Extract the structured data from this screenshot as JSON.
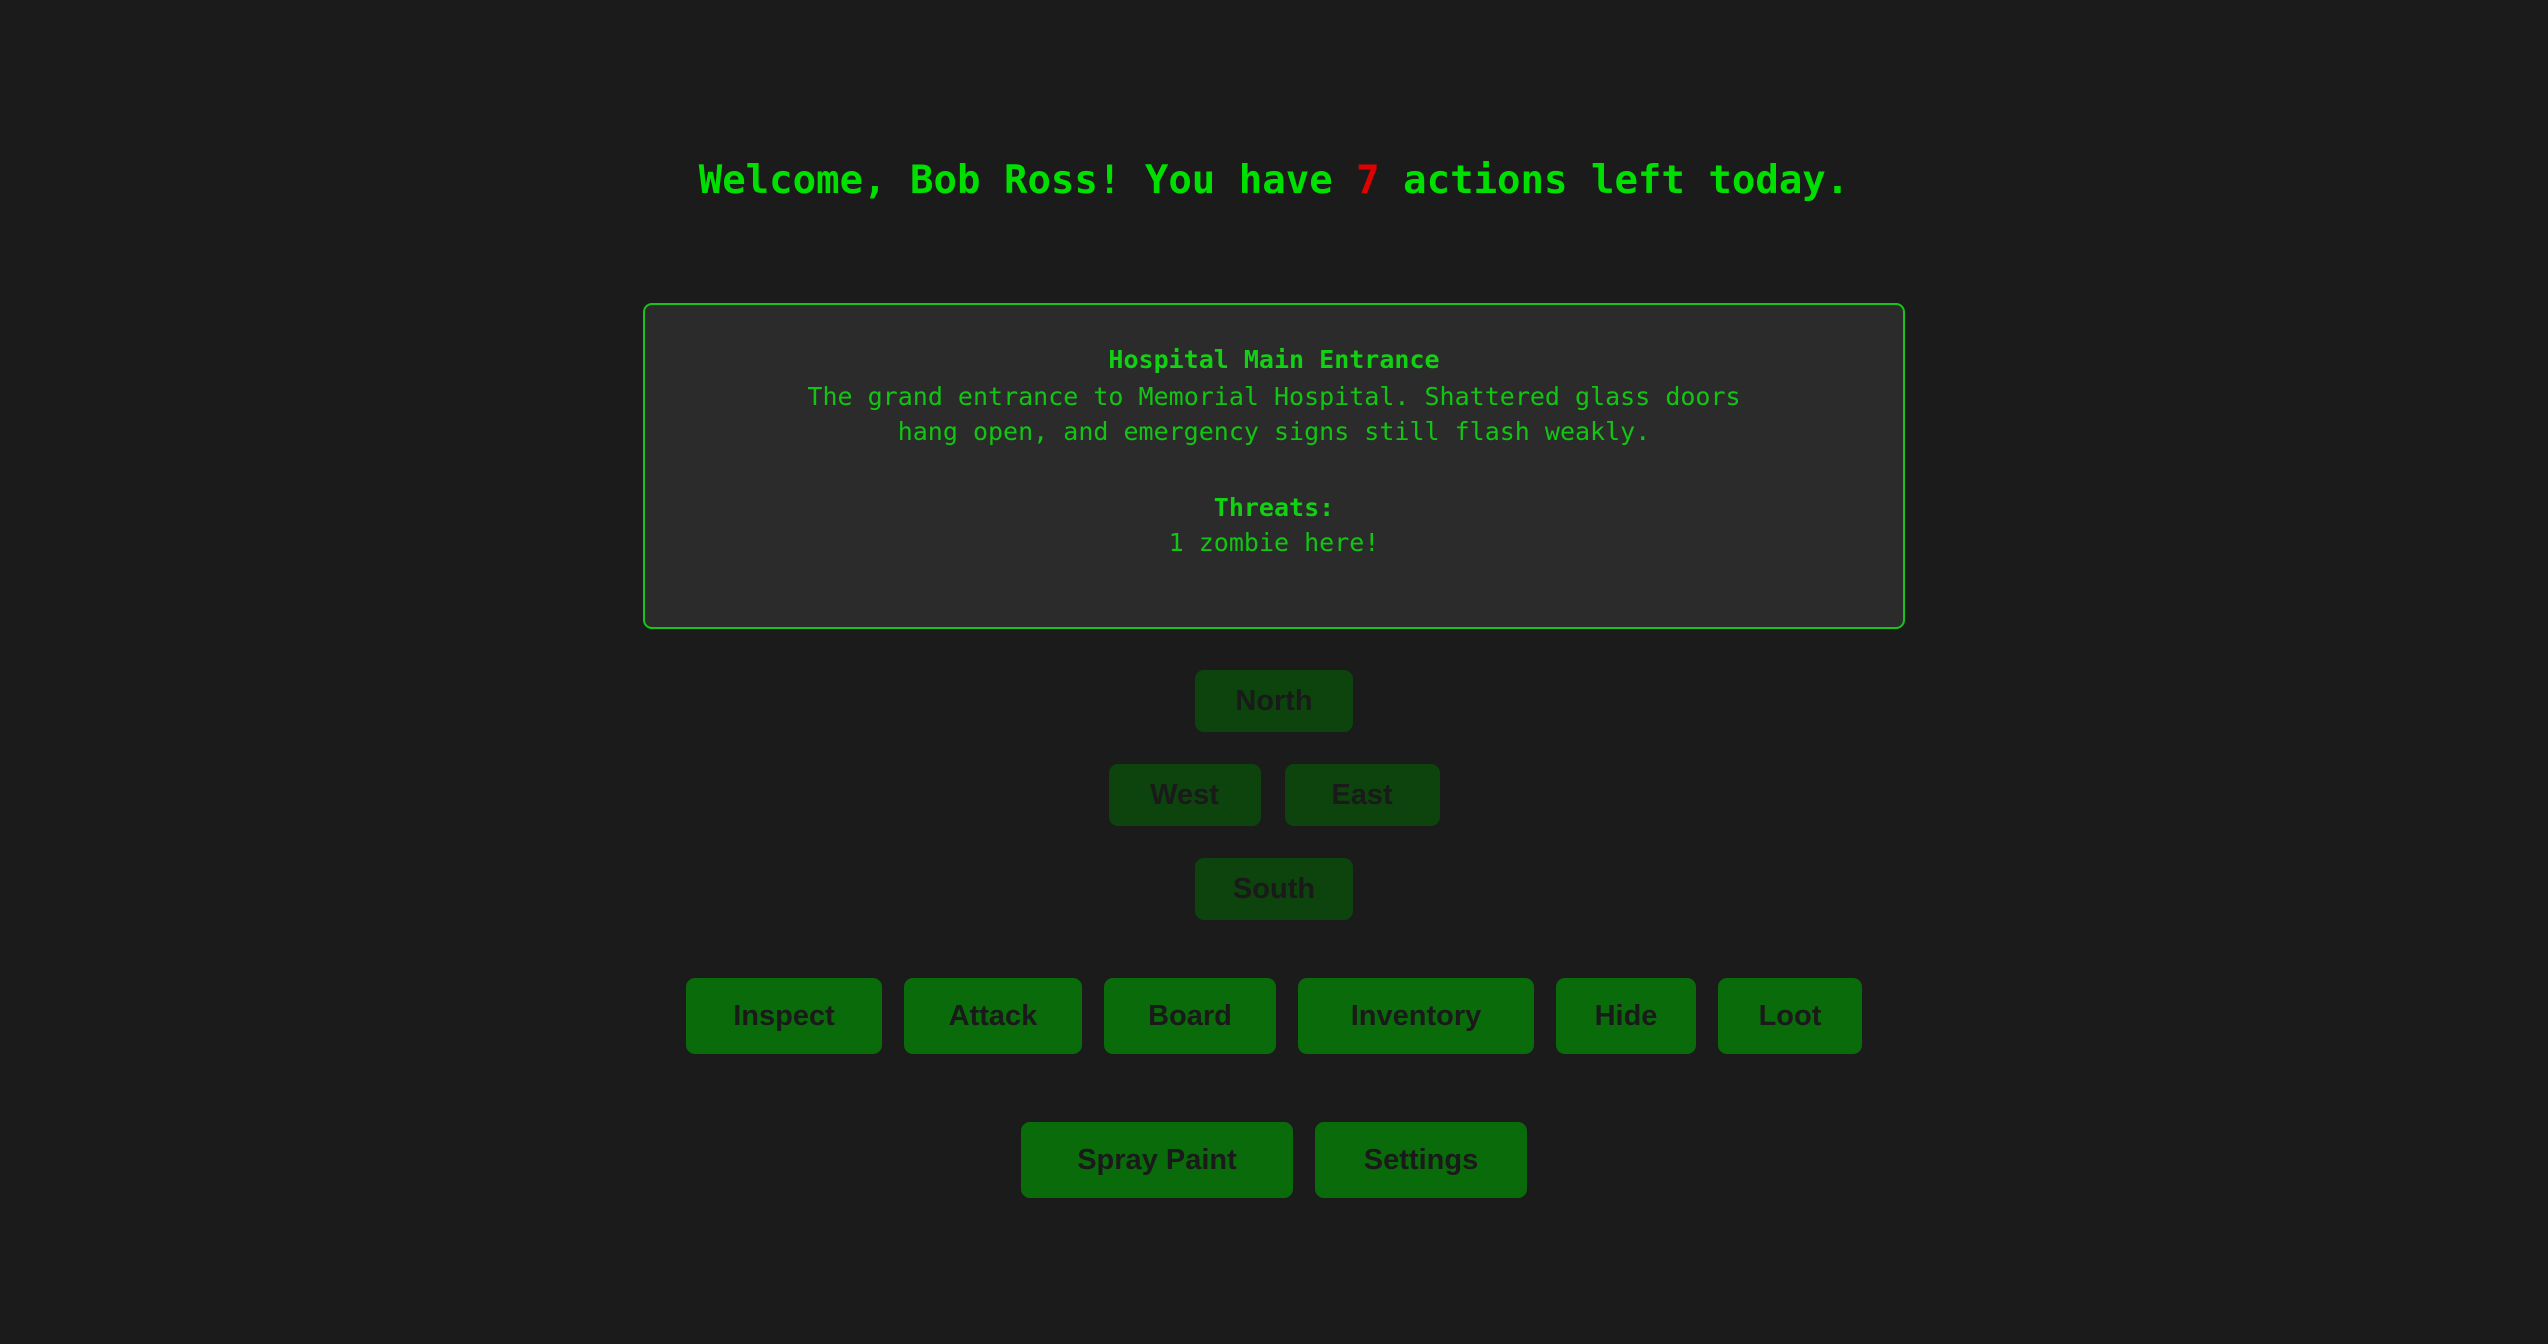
{
  "theme": {
    "page_background": "#1b1b1b",
    "panel_background": "#2b2b2b",
    "panel_border": "#19c419",
    "text_green": "#00e000",
    "accent_red": "#e00000",
    "direction_button_fill": "#0d430d",
    "action_button_fill": "#0a6b0a",
    "button_label_color": "#1a1a1a"
  },
  "header": {
    "greeting_prefix": "Welcome, ",
    "player_name": "Bob Ross",
    "greeting_middle": "! You have ",
    "actions_left": "7",
    "greeting_suffix": " actions left today.",
    "full_text": "Welcome, Bob Ross! You have 7 actions left today."
  },
  "location": {
    "name": "Hospital Main Entrance",
    "description": "The grand entrance to Memorial Hospital. Shattered glass doors\nhang open, and emergency signs still flash weakly.",
    "threats_label": "Threats:",
    "threats_value": "1 zombie here!"
  },
  "directions": {
    "north": "North",
    "west": "West",
    "east": "East",
    "south": "South"
  },
  "actions": {
    "primary": [
      {
        "label": "Inspect"
      },
      {
        "label": "Attack"
      },
      {
        "label": "Board"
      },
      {
        "label": "Inventory"
      },
      {
        "label": "Hide"
      },
      {
        "label": "Loot"
      }
    ],
    "secondary": [
      {
        "label": "Spray Paint"
      },
      {
        "label": "Settings"
      }
    ]
  }
}
